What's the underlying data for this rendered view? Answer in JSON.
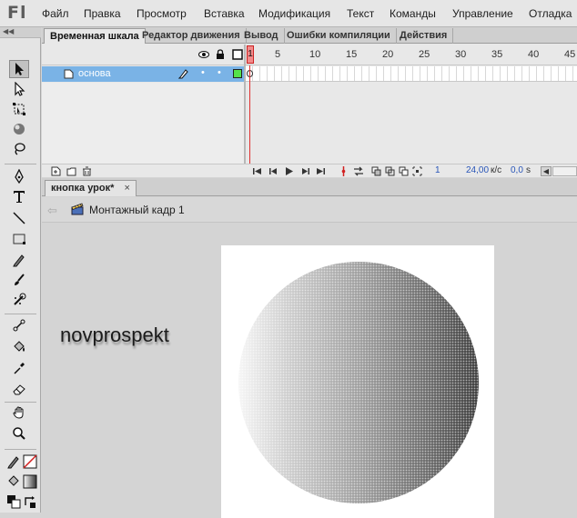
{
  "app": {
    "logo": "Fl"
  },
  "menu": {
    "items": [
      "Файл",
      "Правка",
      "Просмотр",
      "Вставка",
      "Модификация",
      "Текст",
      "Команды",
      "Управление",
      "Отладка"
    ]
  },
  "timeline": {
    "tabs": [
      "Временная шкала",
      "Редактор движения",
      "Вывод",
      "Ошибки компиляции",
      "Действия"
    ],
    "active_tab": "Временная шкала",
    "ruler": [
      "5",
      "10",
      "15",
      "20",
      "25",
      "30",
      "35",
      "40",
      "45"
    ],
    "playhead_label": "1",
    "layer": {
      "name": "основа",
      "color": "#55e24a"
    },
    "footer": {
      "frame": "1",
      "fps": "24,00",
      "fps_unit": "к/с",
      "time": "0,0",
      "time_unit": "s"
    }
  },
  "document": {
    "tab_label": "кнопка урок*",
    "tab_close": "×",
    "scene_label": "Монтажный кадр 1"
  },
  "stage": {
    "text": "novprospekt",
    "background": "#ffffff"
  },
  "colors": {
    "selected_layer": "#7ab3e6",
    "playhead": "#e03030"
  }
}
